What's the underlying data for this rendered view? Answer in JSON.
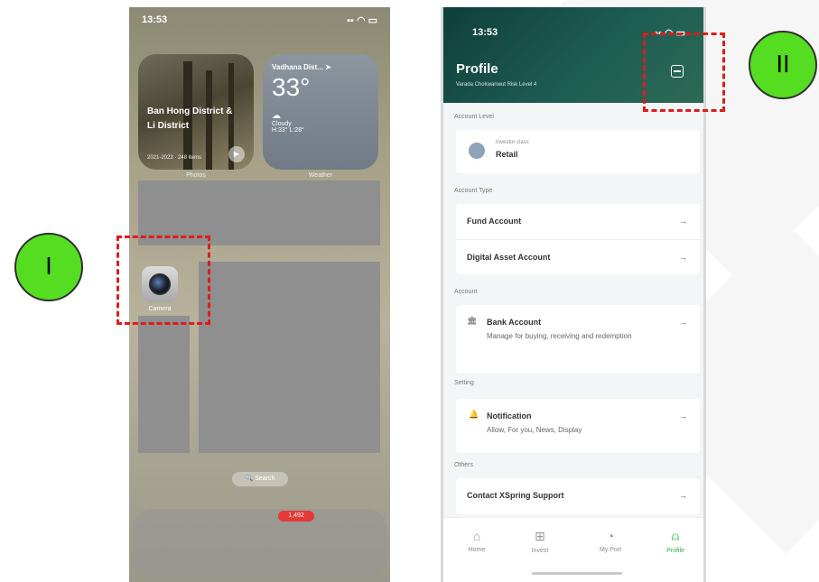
{
  "left_phone": {
    "status_time": "13:53",
    "photos_widget": {
      "title": "Ban Hong District & Li District",
      "sub": "2021-2023 · 248 items",
      "label": "Photos"
    },
    "weather_widget": {
      "location": "Vadhana Dist... ➤",
      "temp": "33°",
      "condition": "Cloudy",
      "high_low": "H:33° L:28°",
      "label": "Weather"
    },
    "camera_label": "Camera",
    "search_label": "🔍 Search",
    "dock_badge": "1,492"
  },
  "markers": {
    "left": "I",
    "right": "II"
  },
  "right_phone": {
    "status_time": "13:53",
    "title": "Profile",
    "subtitle": "Varada Chokwanwut   Risk Level 4",
    "sections": {
      "account_level": "Account Level",
      "account_type": "Account Type",
      "account": "Account",
      "setting": "Setting",
      "others": "Others"
    },
    "investor_class_label": "Investor class",
    "investor_class_value": "Retail",
    "fund_account": "Fund Account",
    "digital_asset_account": "Digital Asset Account",
    "bank_account": "Bank Account",
    "bank_account_desc": "Manage for buying, receiving and redemption",
    "notification": "Notification",
    "notification_desc": "Allow, For you, News, Display",
    "contact_support": "Contact XSpring Support",
    "arrow": "→",
    "tabs": [
      {
        "label": "Home",
        "icon": "⌂"
      },
      {
        "label": "Invest",
        "icon": "⊞"
      },
      {
        "label": "My Port",
        "icon": "◔"
      },
      {
        "label": "Profile",
        "icon": "⍝"
      }
    ]
  }
}
